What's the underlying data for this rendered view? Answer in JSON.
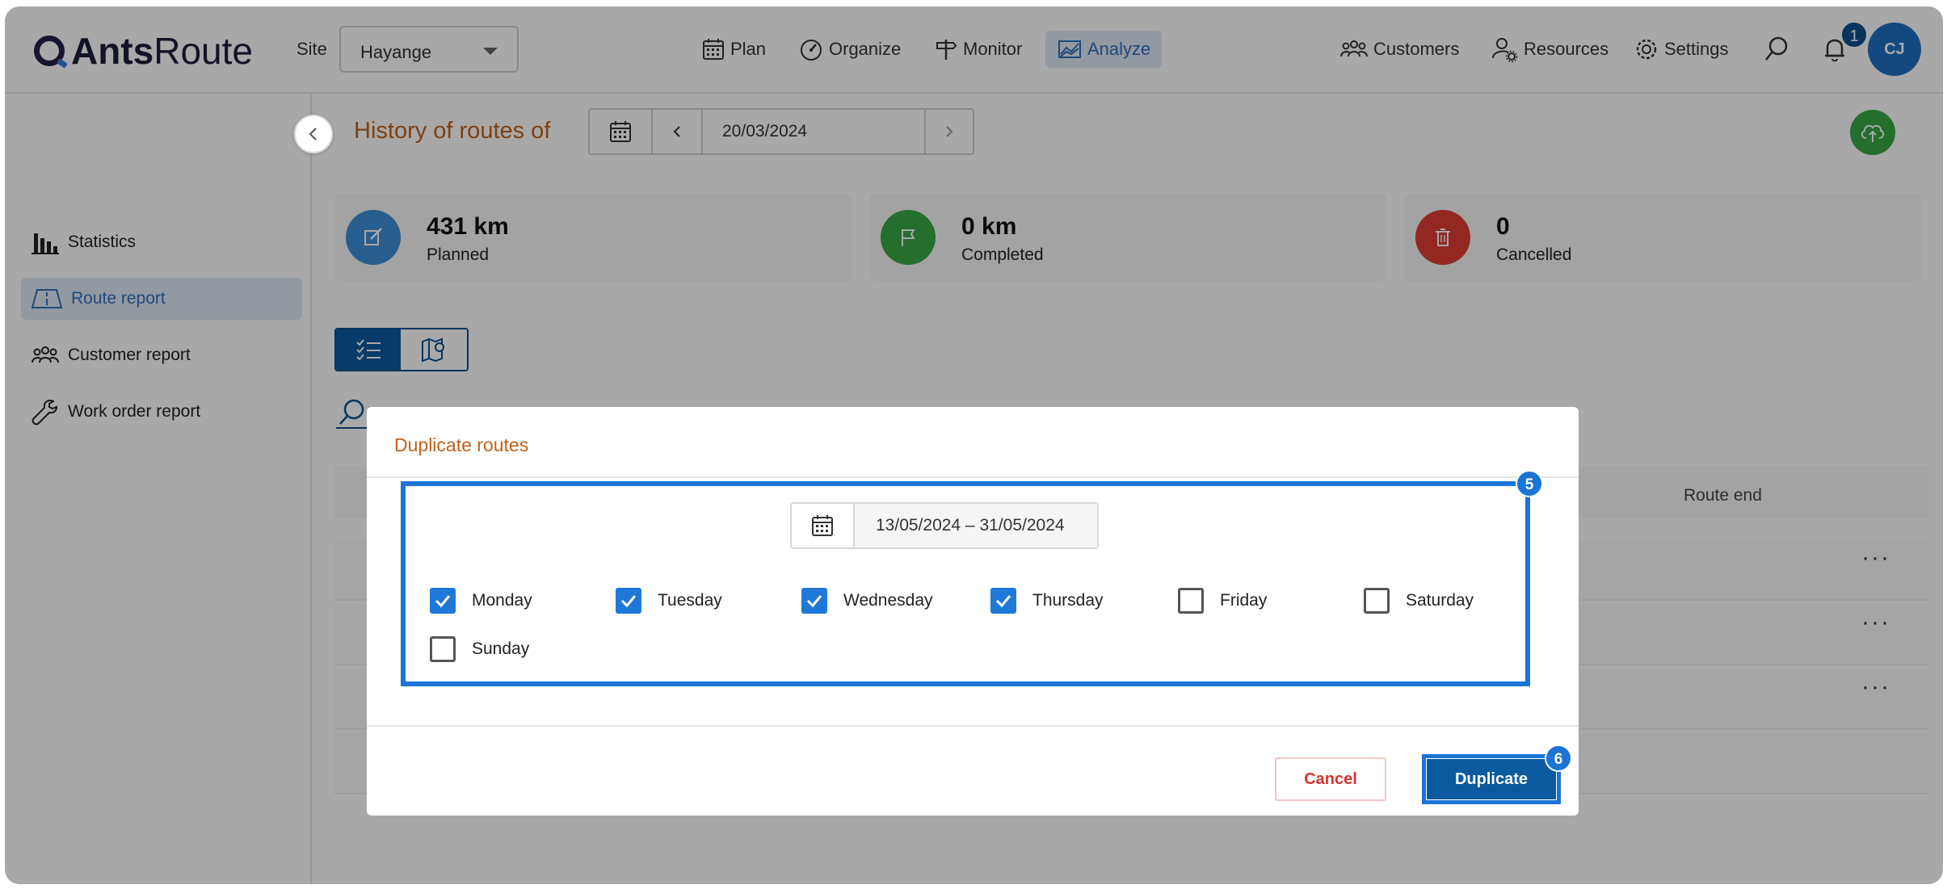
{
  "header": {
    "logo_bold": "Ants",
    "logo_regular": "Route",
    "site_label": "Site",
    "site_value": "Hayange",
    "nav": {
      "plan": "Plan",
      "organize": "Organize",
      "monitor": "Monitor",
      "analyze": "Analyze",
      "customers": "Customers",
      "resources": "Resources",
      "settings": "Settings"
    },
    "notification_count": "1",
    "avatar_initials": "CJ"
  },
  "sidebar": {
    "items": [
      {
        "label": "Statistics",
        "icon": "bar-chart-icon"
      },
      {
        "label": "Route report",
        "icon": "road-icon",
        "active": true
      },
      {
        "label": "Customer report",
        "icon": "group-icon"
      },
      {
        "label": "Work order report",
        "icon": "wrench-icon"
      }
    ]
  },
  "main": {
    "title": "History of routes of",
    "date": "20/03/2024",
    "stats": [
      {
        "value": "431 km",
        "label": "Planned",
        "color": "#3d8fd6"
      },
      {
        "value": "0 km",
        "label": "Completed",
        "color": "#38a847"
      },
      {
        "value": "0",
        "label": "Cancelled",
        "color": "#e03c32"
      }
    ],
    "table": {
      "route_end_header": "Route end"
    }
  },
  "dialog": {
    "title": "Duplicate routes",
    "date_range": "13/05/2024 – 31/05/2024",
    "days": [
      {
        "label": "Monday",
        "checked": true
      },
      {
        "label": "Tuesday",
        "checked": true
      },
      {
        "label": "Wednesday",
        "checked": true
      },
      {
        "label": "Thursday",
        "checked": true
      },
      {
        "label": "Friday",
        "checked": false
      },
      {
        "label": "Saturday",
        "checked": false
      },
      {
        "label": "Sunday",
        "checked": false
      }
    ],
    "cancel_label": "Cancel",
    "duplicate_label": "Duplicate",
    "step_badges": {
      "days": "5",
      "duplicate": "6"
    }
  },
  "colors": {
    "accent": "#1b74d6",
    "primary_dark": "#0b5aa0",
    "title_orange": "#c0611c",
    "danger": "#d9342b"
  }
}
